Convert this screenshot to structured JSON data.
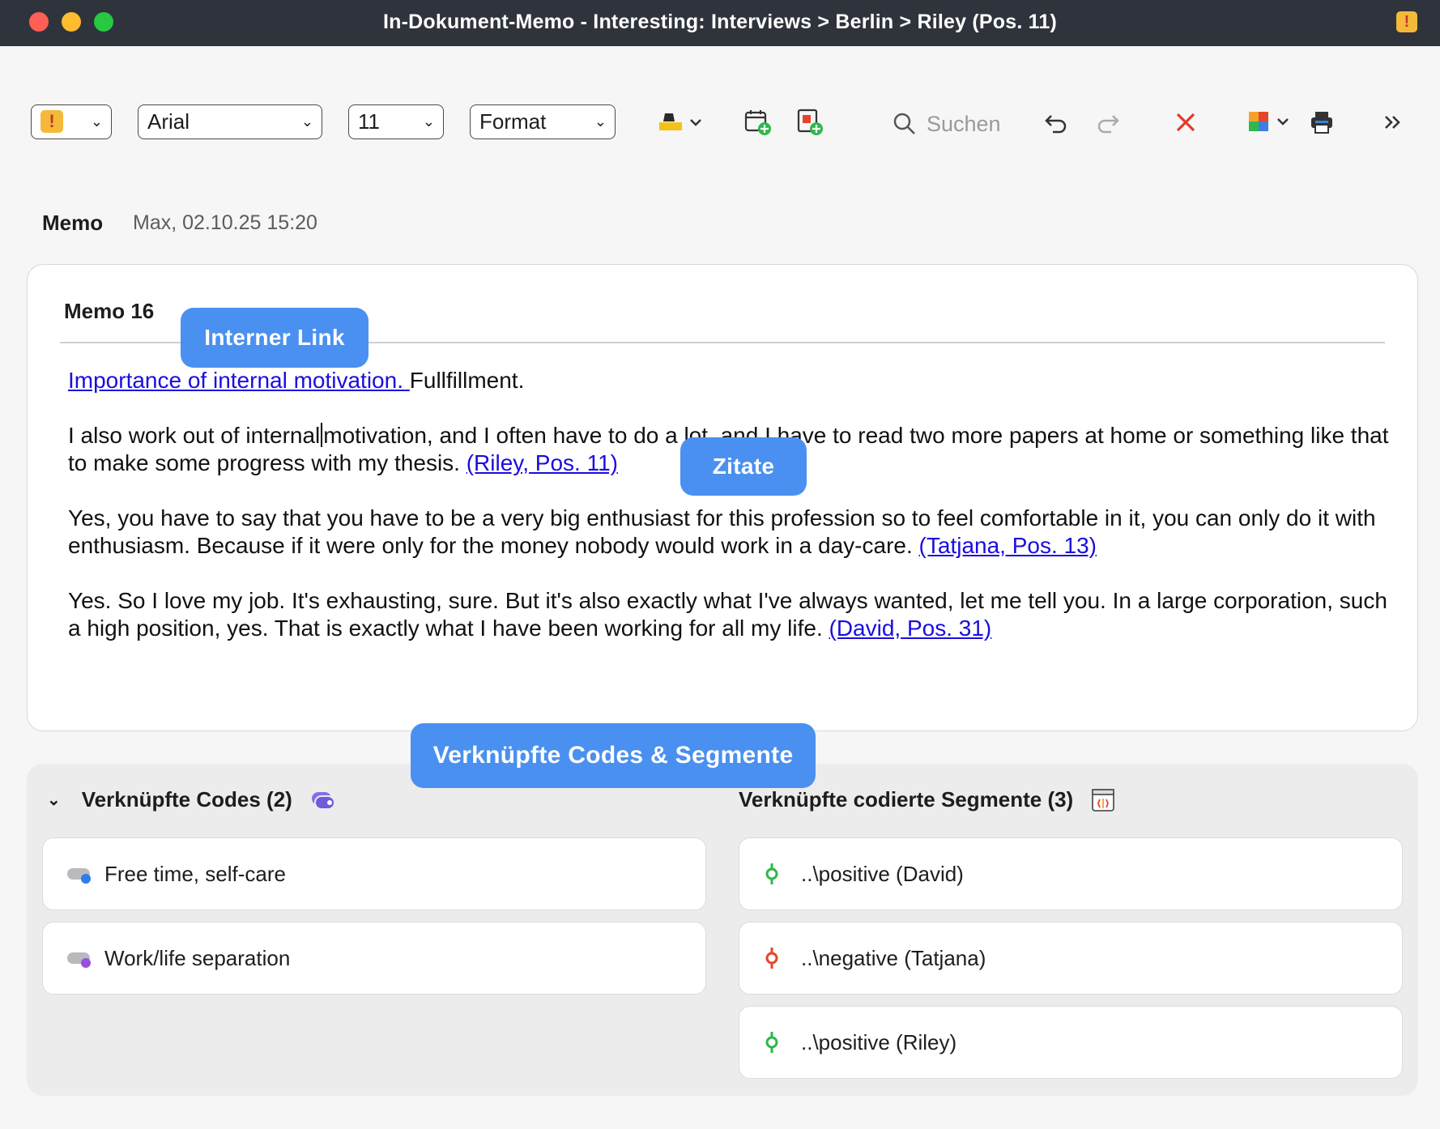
{
  "window": {
    "title": "In-Dokument-Memo - Interesting: Interviews > Berlin > Riley (Pos. 11)",
    "badge": "!"
  },
  "toolbar": {
    "flag_symbol": "!",
    "font": "Arial",
    "size": "11",
    "format": "Format",
    "search_placeholder": "Suchen",
    "icons": [
      "highlighter-icon",
      "add-date-icon",
      "add-code-icon",
      "search-icon",
      "undo-icon",
      "redo-icon",
      "delete-icon",
      "puzzle-icon",
      "print-icon",
      "more-icon"
    ],
    "colors": {
      "flag": "#f5b93a",
      "delete": "#e5382c",
      "highlighter": "#f2c21b"
    }
  },
  "memo": {
    "label": "Memo",
    "meta": "Max, 02.10.25 15:20",
    "title": "Memo 16",
    "link_text": "Importance of internal motivation. ",
    "link_suffix": "Fullfillment.",
    "para1_before_caret": "I also work out of internal",
    "para1_after_caret": "motivation, and I often have to do a lot, and I have to read two more papers at home or something like that to make some progress with my thesis. ",
    "para1_ref": "(Riley, Pos. 11)",
    "para2": "Yes, you have to say that you have to be a very big enthusiast for this profession so to feel comfortable in it, you can only do it with enthusiasm. Because if it were only for the money nobody would work in a day-care. ",
    "para2_ref": "(Tatjana, Pos. 13)",
    "para3": "Yes. So I love my job. It's exhausting, sure. But it's also exactly what I've always wanted, let me tell you. In a large corporation, such a high position, yes. That is exactly what I have been working for all my life. ",
    "para3_ref": "(David, Pos. 31)"
  },
  "callouts": {
    "internal_link": "Interner Link",
    "quotes": "Zitate",
    "linked": "Verknüpfte Codes & Segmente"
  },
  "linked_codes": {
    "heading": "Verknüpfte Codes (2)",
    "items": [
      {
        "label": "Free time, self-care",
        "dot_color": "#2f7bea"
      },
      {
        "label": "Work/life separation",
        "dot_color": "#9b4de0"
      }
    ]
  },
  "linked_segments": {
    "heading": "Verknüpfte codierte Segmente (3)",
    "items": [
      {
        "label": "..\\positive (David)",
        "color": "#2eb84b"
      },
      {
        "label": "..\\negative (Tatjana)",
        "color": "#e5452c"
      },
      {
        "label": "..\\positive (Riley)",
        "color": "#2eb84b"
      }
    ]
  }
}
